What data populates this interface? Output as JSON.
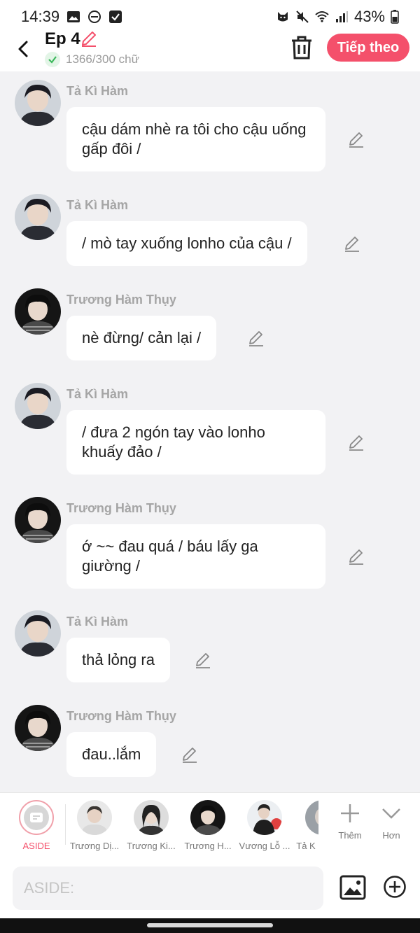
{
  "status": {
    "time": "14:39",
    "battery": "43%",
    "left_icons": [
      "gallery-icon",
      "do-not-disturb-icon",
      "checkbox-icon"
    ],
    "right_icons": [
      "cat-icon",
      "mute-icon",
      "wifi-icon",
      "signal-icon",
      "battery-icon"
    ]
  },
  "header": {
    "title": "Ep 4",
    "word_count": "1366/300 chữ",
    "next_label": "Tiếp theo"
  },
  "colors": {
    "accent": "#f4506b",
    "name": "#a5a5a5",
    "bg": "#f2f2f4"
  },
  "messages": [
    {
      "name": "Tả Kì Hàm",
      "text": "cậu dám nhè ra tôi cho cậu uống gấp đôi /"
    },
    {
      "name": "Tả Kì Hàm",
      "text": "/ mò tay xuống lonho của cậu /"
    },
    {
      "name": "Trương Hàm Thụy",
      "text": "nè đừng/ cản lại /"
    },
    {
      "name": "Tả Kì Hàm",
      "text": "/ đưa 2 ngón tay vào lonho khuấy đảo /"
    },
    {
      "name": "Trương Hàm Thụy",
      "text": "ớ ~~ đau quá / báu lấy ga giường /"
    },
    {
      "name": "Tả Kì Hàm",
      "text": "thả lỏng ra"
    },
    {
      "name": "Trương Hàm Thụy",
      "text": "đau..lắm"
    }
  ],
  "characters": {
    "aside_label": "ASIDE",
    "list": [
      {
        "label": "Trương Dị..."
      },
      {
        "label": "Trương Ki..."
      },
      {
        "label": "Trương H..."
      },
      {
        "label": "Vương Lỗ ..."
      },
      {
        "label": "Tả K"
      }
    ],
    "add_label": "Thêm",
    "more_label": "Hơn"
  },
  "input": {
    "placeholder": "ASIDE:"
  }
}
